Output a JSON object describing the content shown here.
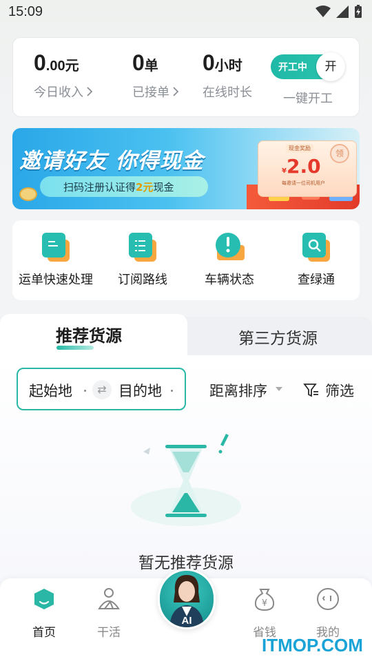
{
  "status_bar": {
    "time": "15:09"
  },
  "stats": {
    "income": {
      "value_main": "0",
      "value_decimal": ".00",
      "unit": "元",
      "label": "今日收入"
    },
    "orders": {
      "value": "0",
      "unit": "单",
      "label": "已接单"
    },
    "hours": {
      "value": "0",
      "unit": "小时",
      "label": "在线时长"
    },
    "work_toggle": {
      "state_label": "开工中",
      "knob_label": "开",
      "caption": "一键开工",
      "on": true
    }
  },
  "banner": {
    "headline": "邀请好友 你得现金",
    "pill_text_before": "扫码注册认证得",
    "pill_highlight": "2元",
    "pill_text_after": "现金",
    "card_tag": "现金奖励",
    "card_currency": "¥",
    "card_amount": "2.0",
    "card_note": "每邀请一位司机用户",
    "card_stamp": "领"
  },
  "quick_actions": [
    {
      "label": "运单快速处理",
      "icon": "waybill-icon"
    },
    {
      "label": "订阅路线",
      "icon": "subscribe-route-icon"
    },
    {
      "label": "车辆状态",
      "icon": "vehicle-status-icon"
    },
    {
      "label": "查绿通",
      "icon": "search-green-pass-icon"
    }
  ],
  "tabs": {
    "active": "推荐货源",
    "inactive": "第三方货源"
  },
  "filters": {
    "origin": "起始地",
    "destination": "目的地",
    "sort": "距离排序",
    "filter": "筛选"
  },
  "empty_state": {
    "text": "暂无推荐货源"
  },
  "bottom_nav": {
    "items": [
      {
        "label": "首页",
        "icon": "home-icon",
        "active": true
      },
      {
        "label": "干活",
        "icon": "work-icon",
        "active": false
      },
      {
        "label": "AI",
        "icon": "ai-avatar-icon",
        "active": false
      },
      {
        "label": "省钱",
        "icon": "money-bag-icon",
        "active": false
      },
      {
        "label": "我的",
        "icon": "profile-icon",
        "active": false
      }
    ]
  },
  "watermark": "ITMOP.COM",
  "colors": {
    "accent": "#2ab7a5",
    "orange": "#f7a640",
    "banner_blue": "#2aa7e8",
    "red": "#e4392b"
  }
}
